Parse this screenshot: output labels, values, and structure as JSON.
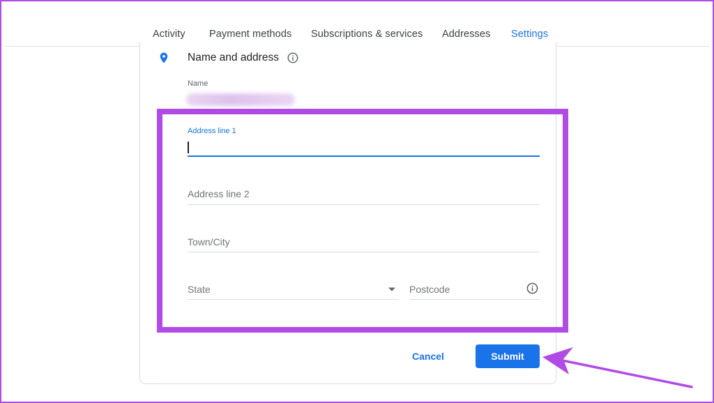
{
  "tabs": [
    {
      "label": "Activity"
    },
    {
      "label": "Payment methods"
    },
    {
      "label": "Subscriptions & services"
    },
    {
      "label": "Addresses"
    },
    {
      "label": "Settings",
      "active": true
    }
  ],
  "section": {
    "title": "Name and address",
    "name_label": "Name"
  },
  "form": {
    "address_line_1": {
      "label": "Address line 1",
      "value": ""
    },
    "address_line_2": {
      "placeholder": "Address line 2"
    },
    "town_city": {
      "placeholder": "Town/City"
    },
    "state": {
      "placeholder": "State"
    },
    "postcode": {
      "placeholder": "Postcode"
    }
  },
  "actions": {
    "cancel_label": "Cancel",
    "submit_label": "Submit"
  },
  "colors": {
    "accent": "#1a73e8",
    "highlight": "#b04be6"
  },
  "icons": [
    "location-pin-icon",
    "info-icon",
    "chevron-down-icon"
  ]
}
